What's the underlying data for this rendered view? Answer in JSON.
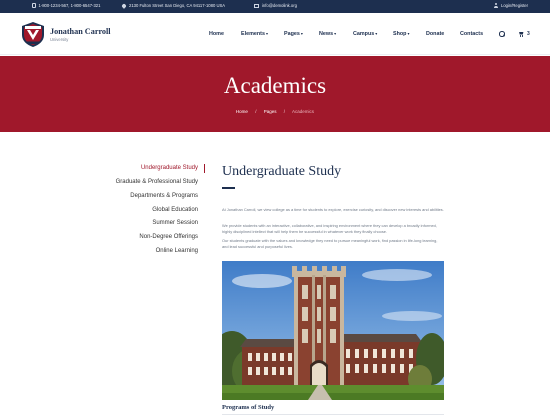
{
  "topbar": {
    "phone": "1-800-1234-567, 1-800-6547-321",
    "address": "2130 Fulton Street San Diego, CA 94117-1080 USA",
    "email": "info@demolink.org",
    "login": "Login/Register"
  },
  "brand": {
    "name": "Jonathan Carroll",
    "subtitle": "University"
  },
  "nav": {
    "items": [
      {
        "label": "Home",
        "dropdown": false
      },
      {
        "label": "Elements",
        "dropdown": true
      },
      {
        "label": "Pages",
        "dropdown": true
      },
      {
        "label": "News",
        "dropdown": true
      },
      {
        "label": "Campus",
        "dropdown": true
      },
      {
        "label": "Shop",
        "dropdown": true
      },
      {
        "label": "Donate",
        "dropdown": false
      },
      {
        "label": "Contacts",
        "dropdown": false
      }
    ],
    "caret": "▾",
    "cart_count": "3"
  },
  "hero": {
    "title": "Academics",
    "breadcrumbs": [
      "Home",
      "Pages",
      "Academics"
    ],
    "separator": "/"
  },
  "sidebar": {
    "items": [
      {
        "label": "Undergraduate Study",
        "active": true
      },
      {
        "label": "Graduate & Professional Study",
        "active": false
      },
      {
        "label": "Departments & Programs",
        "active": false
      },
      {
        "label": "Global Education",
        "active": false
      },
      {
        "label": "Summer Session",
        "active": false
      },
      {
        "label": "Non-Degree Offerings",
        "active": false
      },
      {
        "label": "Online Learning",
        "active": false
      }
    ]
  },
  "main": {
    "title": "Undergraduate Study",
    "paragraphs": [
      "At Jonathan Carroll, we view college as a time for students to explore, exercise curiosity, and discover new interests and abilities.",
      "We provide students with an interactive, collaborative, and inspiring environment where they can develop a broadly informed, highly disciplined intellect that will help them be successful in whatever work they finally choose.",
      "Our students graduate with the values and knowledge they need to pursue meaningful work, find passion in life-long learning, and lead successful and purposeful lives."
    ],
    "section_title": "Programs of Study"
  },
  "colors": {
    "navy": "#1d2f4f",
    "crimson": "#a0182b",
    "text": "#333333",
    "muted": "#707a88"
  }
}
